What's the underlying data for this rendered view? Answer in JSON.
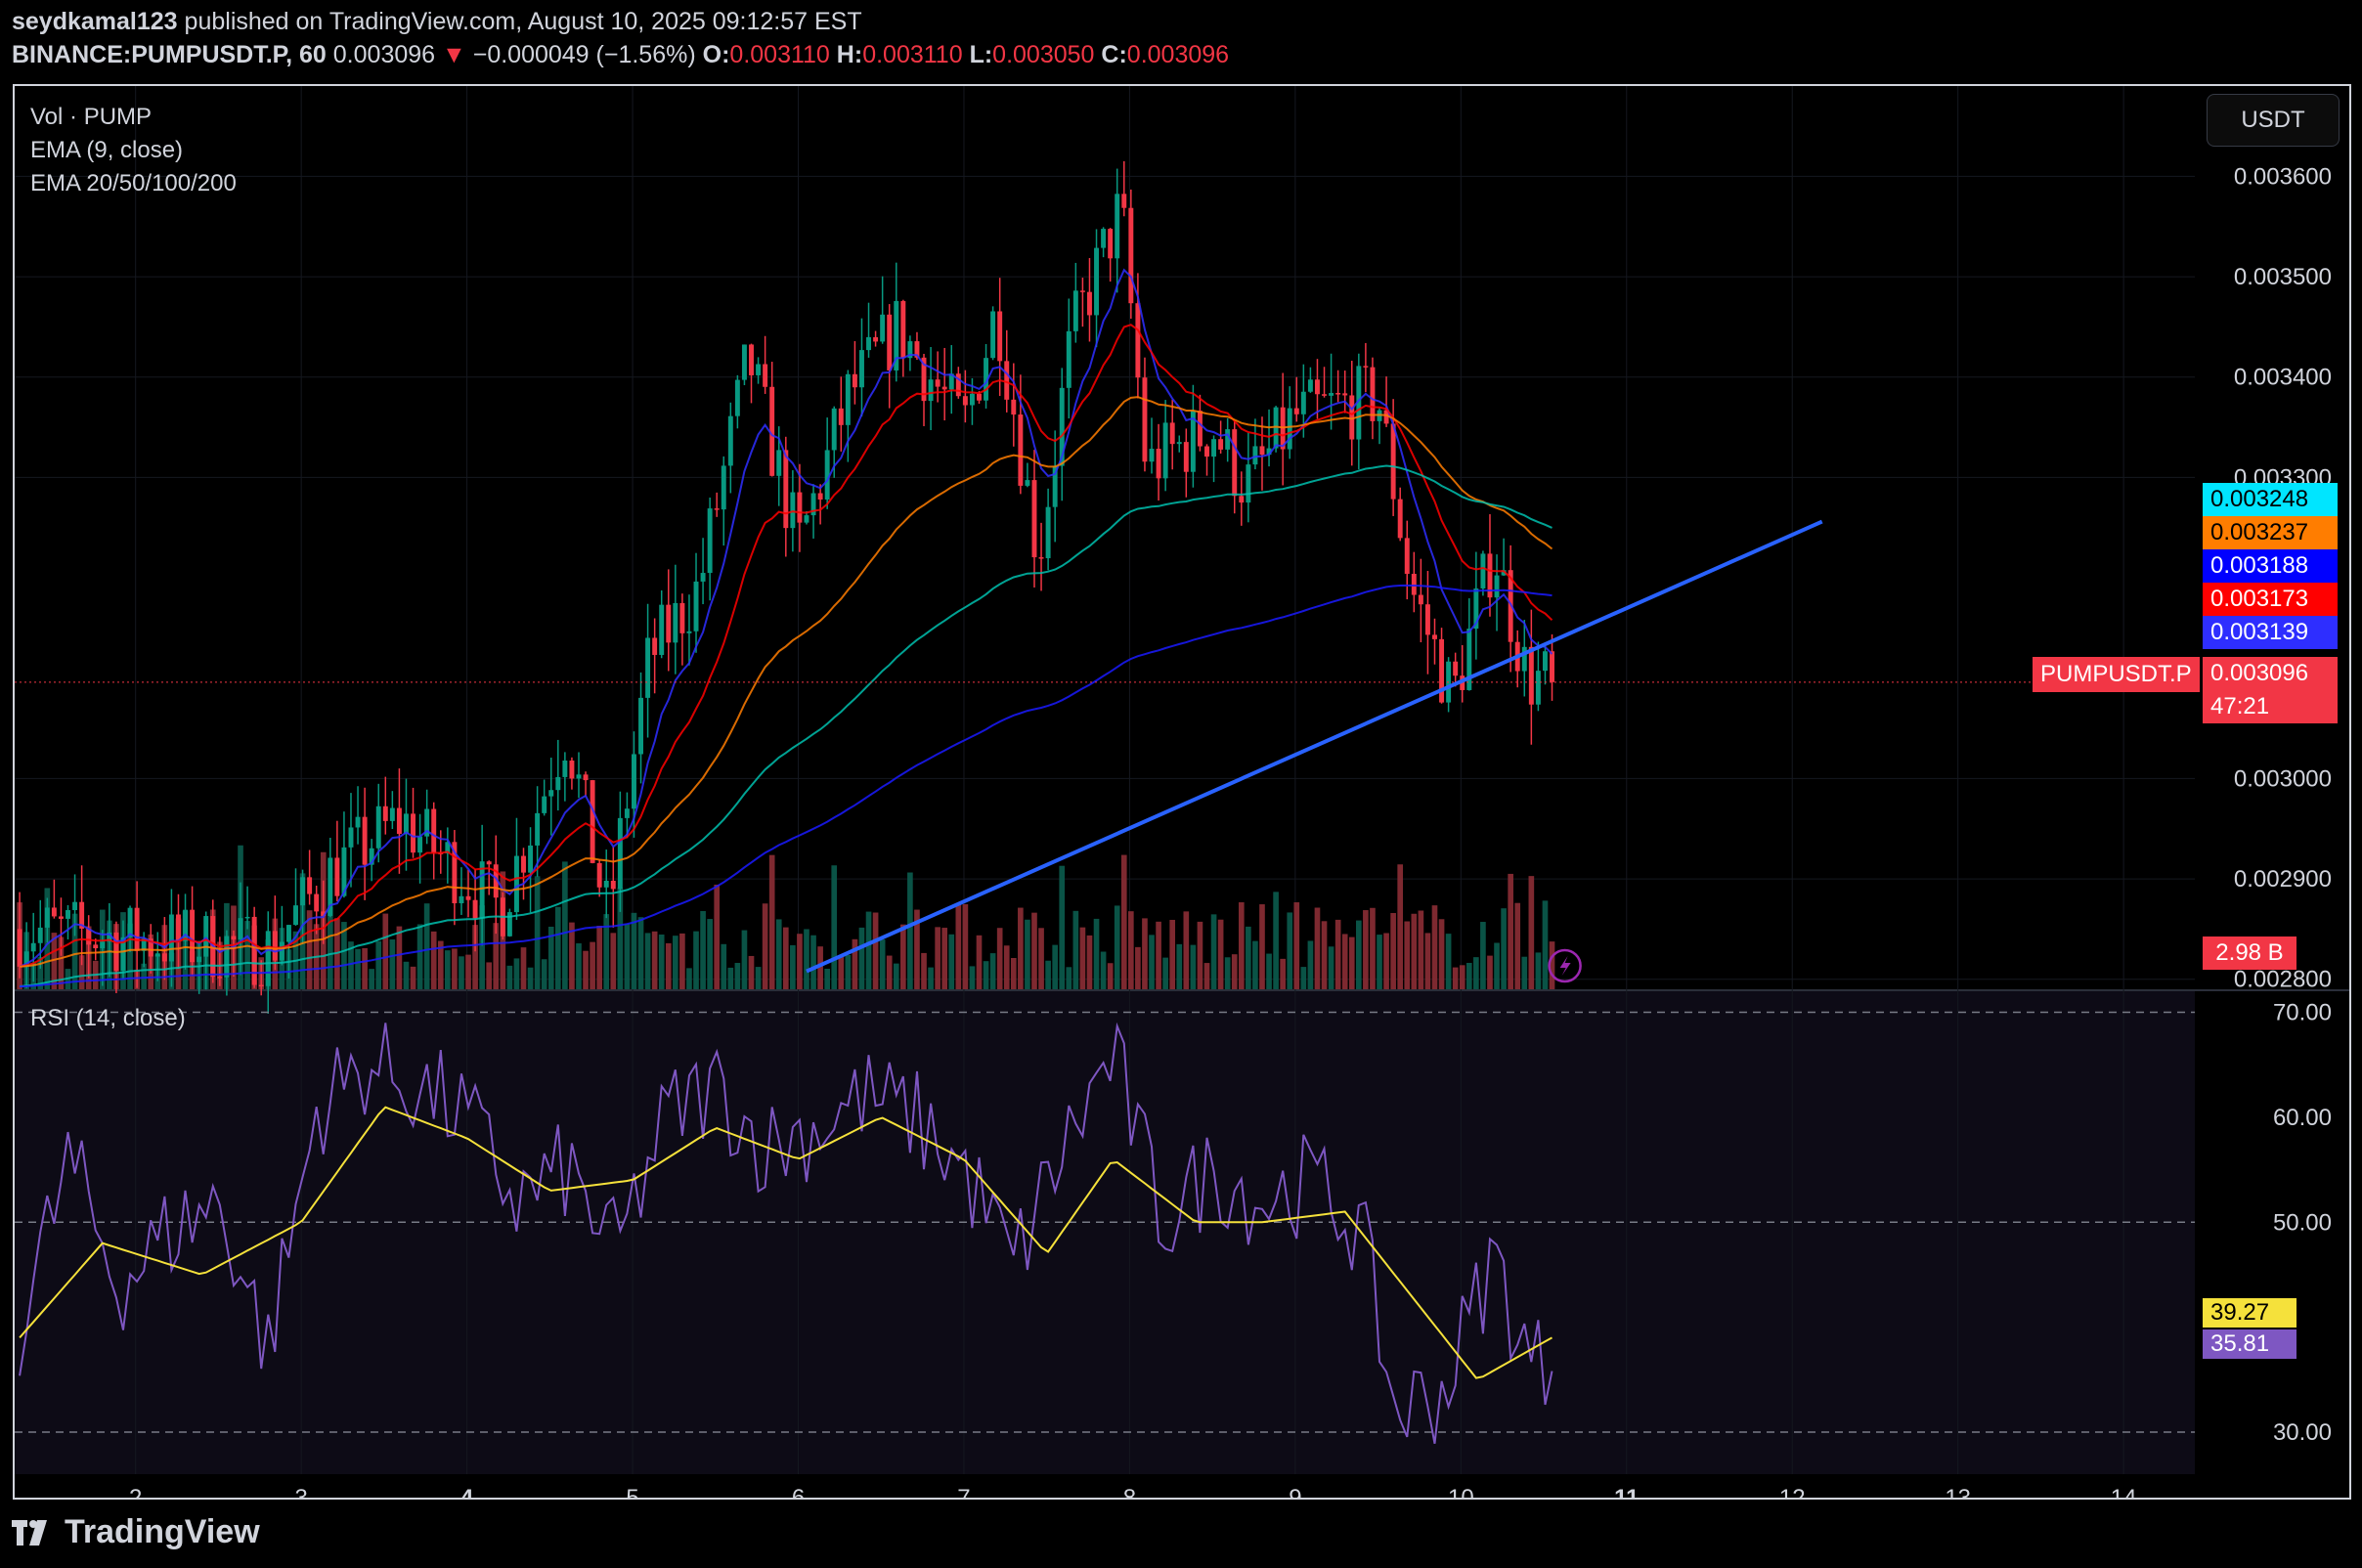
{
  "header": {
    "author": "seydkamal123",
    "published_text": "published on TradingView.com, August 10, 2025 09:12:57 EST",
    "symbol": "BINANCE:PUMPUSDT.P, 60",
    "last": "0.003096",
    "change_arrow": "▼",
    "change": "−0.000049 (−1.56%)",
    "open_label": "O:",
    "open": "0.003110",
    "high_label": "H:",
    "high": "0.003110",
    "low_label": "L:",
    "low": "0.003050",
    "close_label": "C:",
    "close": "0.003096"
  },
  "legend": {
    "vol": "Vol · PUMP",
    "ema9": "EMA (9, close)",
    "ema_multi": "EMA 20/50/100/200",
    "rsi": "RSI (14, close)"
  },
  "currency_button": "USDT",
  "price_badges": [
    {
      "value": "0.003248",
      "bg": "#00e5ff",
      "fg": "#000000"
    },
    {
      "value": "0.003237",
      "bg": "#ff7d00",
      "fg": "#000000"
    },
    {
      "value": "0.003188",
      "bg": "#0000ff",
      "fg": "#ffffff"
    },
    {
      "value": "0.003173",
      "bg": "#ff0000",
      "fg": "#ffffff"
    },
    {
      "value": "0.003139",
      "bg": "#2e2eff",
      "fg": "#ffffff"
    }
  ],
  "symbol_badge": {
    "name": "PUMPUSDT.P",
    "price": "0.003096",
    "countdown": "47:21"
  },
  "volume_badge": "2.98 B",
  "rsi_badges": {
    "signal": "39.27",
    "rsi": "35.81"
  },
  "footer": {
    "brand": "TradingView"
  },
  "colors": {
    "up": "#089981",
    "down": "#f23645",
    "trendline": "#2962ff",
    "rsi": "#7e57c2",
    "rsi_ma": "#f5e13b"
  },
  "chart_data": {
    "type": "candlestick",
    "symbol": "BINANCE:PUMPUSDT.P",
    "interval": "60",
    "x_ticks": [
      "2",
      "3",
      "4",
      "5",
      "6",
      "7",
      "8",
      "9",
      "10",
      "11",
      "12",
      "13",
      "14"
    ],
    "price_ticks": [
      "0.003600",
      "0.003500",
      "0.003400",
      "0.003300",
      "0.003000",
      "0.002900",
      "0.002800"
    ],
    "price_ylim": [
      0.00279,
      0.00369
    ],
    "x_range_days": [
      1.27,
      14.43
    ],
    "last_bar_day": 10.58,
    "current_price": 0.003096,
    "trendline": {
      "start": {
        "day": 6.05,
        "price": 0.002808
      },
      "end": {
        "day": 12.18,
        "price": 0.003256
      }
    },
    "ema_last_values": {
      "ema9": 0.003139,
      "ema20": 0.003173,
      "ema50": 0.003237,
      "ema100": 0.003248,
      "ema200": 0.003188
    },
    "price_path": [
      [
        1.3,
        0.00285
      ],
      [
        2.0,
        0.00284
      ],
      [
        2.8,
        0.00283
      ],
      [
        3.2,
        0.00291
      ],
      [
        3.6,
        0.00296
      ],
      [
        4.2,
        0.00287
      ],
      [
        4.6,
        0.00305
      ],
      [
        4.85,
        0.00286
      ],
      [
        5.1,
        0.00312
      ],
      [
        5.4,
        0.00319
      ],
      [
        5.7,
        0.00342
      ],
      [
        6.0,
        0.00323
      ],
      [
        6.3,
        0.00338
      ],
      [
        6.6,
        0.00345
      ],
      [
        7.0,
        0.00335
      ],
      [
        7.2,
        0.00347
      ],
      [
        7.45,
        0.00322
      ],
      [
        7.65,
        0.00344
      ],
      [
        7.95,
        0.00357
      ],
      [
        8.1,
        0.00331
      ],
      [
        8.5,
        0.00335
      ],
      [
        8.7,
        0.00329
      ],
      [
        9.0,
        0.00336
      ],
      [
        9.5,
        0.00338
      ],
      [
        9.7,
        0.00319
      ],
      [
        9.95,
        0.00308
      ],
      [
        10.2,
        0.00323
      ],
      [
        10.4,
        0.0031
      ],
      [
        10.58,
        0.003096
      ]
    ],
    "volume_badge_value": "2.98 B",
    "rsi": {
      "ticks": [
        "70.00",
        "60.00",
        "50.00",
        "30.00"
      ],
      "bands": [
        70,
        50,
        30
      ],
      "ylim": [
        26,
        72
      ],
      "last_rsi": 35.81,
      "last_signal": 39.27,
      "rsi_path": [
        [
          1.3,
          40
        ],
        [
          1.6,
          56
        ],
        [
          1.9,
          44
        ],
        [
          2.2,
          49
        ],
        [
          2.5,
          52
        ],
        [
          2.8,
          38
        ],
        [
          3.1,
          61
        ],
        [
          3.4,
          65
        ],
        [
          3.7,
          63
        ],
        [
          4.0,
          60
        ],
        [
          4.3,
          52
        ],
        [
          4.6,
          55
        ],
        [
          4.9,
          47
        ],
        [
          5.2,
          60
        ],
        [
          5.5,
          63
        ],
        [
          5.8,
          57
        ],
        [
          6.1,
          59
        ],
        [
          6.4,
          62
        ],
        [
          6.7,
          60
        ],
        [
          7.0,
          55
        ],
        [
          7.3,
          46
        ],
        [
          7.6,
          57
        ],
        [
          7.9,
          66
        ],
        [
          8.2,
          50
        ],
        [
          8.5,
          55
        ],
        [
          8.8,
          52
        ],
        [
          9.1,
          54
        ],
        [
          9.4,
          49
        ],
        [
          9.6,
          32
        ],
        [
          9.9,
          34
        ],
        [
          10.2,
          47
        ],
        [
          10.4,
          37
        ],
        [
          10.58,
          35.81
        ]
      ],
      "signal_path": [
        [
          1.3,
          39
        ],
        [
          1.8,
          48
        ],
        [
          2.4,
          45
        ],
        [
          3.0,
          50
        ],
        [
          3.5,
          61
        ],
        [
          4.0,
          58
        ],
        [
          4.5,
          53
        ],
        [
          5.0,
          54
        ],
        [
          5.5,
          59
        ],
        [
          6.0,
          56
        ],
        [
          6.5,
          60
        ],
        [
          7.0,
          56
        ],
        [
          7.5,
          47
        ],
        [
          7.9,
          56
        ],
        [
          8.4,
          50
        ],
        [
          8.8,
          50
        ],
        [
          9.3,
          51
        ],
        [
          9.7,
          43
        ],
        [
          10.1,
          35
        ],
        [
          10.58,
          39.27
        ]
      ]
    }
  }
}
